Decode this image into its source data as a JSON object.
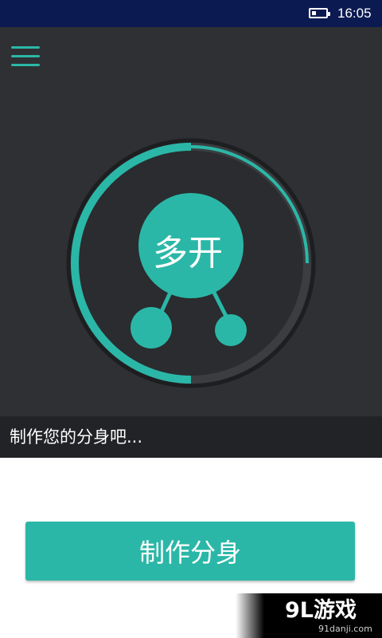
{
  "status_bar": {
    "time": "16:05",
    "battery_level": 0.3
  },
  "hero": {
    "logo_text": "多开",
    "caption": "制作您的分身吧...",
    "progress_arc_color": "#2bb7a7",
    "background_color": "#2e3033"
  },
  "primary_action": {
    "label": "制作分身",
    "color": "#2bb7a7"
  },
  "watermark": {
    "logo": "9L游戏",
    "url": "91danji.com"
  }
}
